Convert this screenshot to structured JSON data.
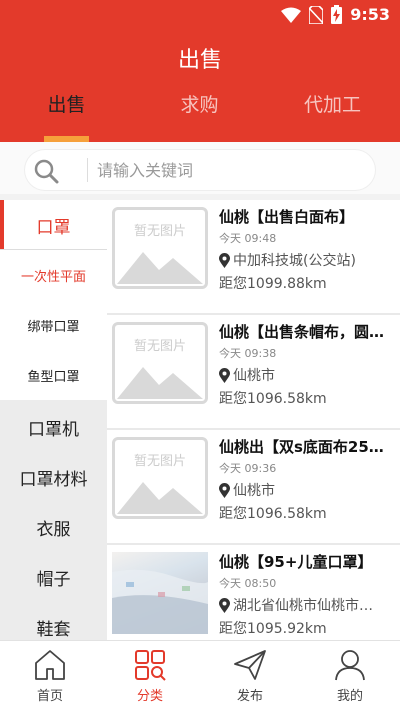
{
  "status_bar": {
    "time": "9:53"
  },
  "header": {
    "title": "出售",
    "tabs": [
      {
        "label": "出售",
        "active": true
      },
      {
        "label": "求购",
        "active": false
      },
      {
        "label": "代加工",
        "active": false
      }
    ]
  },
  "search": {
    "placeholder": "请输入关键词"
  },
  "sidebar": {
    "items": [
      {
        "label": "口罩"
      },
      {
        "label": "一次性平面"
      },
      {
        "label": "绑带口罩"
      },
      {
        "label": "鱼型口罩"
      },
      {
        "label": "口罩机"
      },
      {
        "label": "口罩材料"
      },
      {
        "label": "衣服"
      },
      {
        "label": "帽子"
      },
      {
        "label": "鞋套"
      }
    ]
  },
  "listings": [
    {
      "title": "仙桃【出售白面布】",
      "time": "今天  09:48",
      "location": "中加科技城(公交站)",
      "distance": "距您1099.88km",
      "image": "暂无图片"
    },
    {
      "title": "仙桃【出售条帽布，圆…",
      "time": "今天  09:38",
      "location": "仙桃市",
      "distance": "距您1096.58km",
      "image": "暂无图片"
    },
    {
      "title": "仙桃出【双s底面布25…",
      "time": "今天  09:36",
      "location": "仙桃市",
      "distance": "距您1096.58km",
      "image": "暂无图片"
    },
    {
      "title": "仙桃【95+儿童口罩】",
      "time": "今天  08:50",
      "location": "湖北省仙桃市仙桃市…",
      "distance": "距您1095.92km",
      "image": ""
    }
  ],
  "bottom_nav": [
    {
      "label": "首页",
      "icon": "home-icon"
    },
    {
      "label": "分类",
      "icon": "category-icon"
    },
    {
      "label": "发布",
      "icon": "send-icon"
    },
    {
      "label": "我的",
      "icon": "profile-icon"
    }
  ],
  "colors": {
    "primary": "#e33a2b",
    "tab_indicator": "#f6a03b"
  }
}
